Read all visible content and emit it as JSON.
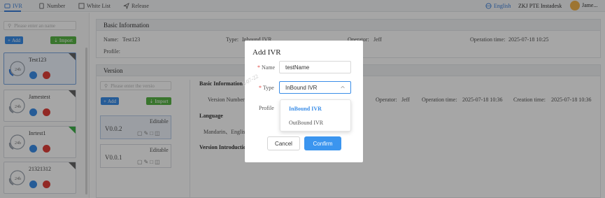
{
  "topnav": {
    "tabs": [
      {
        "label": "IVR"
      },
      {
        "label": "Number"
      },
      {
        "label": "White List"
      },
      {
        "label": "Release"
      }
    ],
    "language": "English",
    "company": "ZKJ PTE Instadesk",
    "user": "Jame..."
  },
  "sidebar": {
    "search_placeholder": "Please enter an name",
    "add_label": "Add",
    "import_label": "Import",
    "cards": [
      {
        "name": "Test123"
      },
      {
        "name": "Jamestest"
      },
      {
        "name": "Inrtest1"
      },
      {
        "name": "21321312"
      }
    ],
    "phone_badge": "24h"
  },
  "basic_info": {
    "title": "Basic Information",
    "name_label": "Name:",
    "name_value": "Test123",
    "type_label": "Type:",
    "type_value": "Inbound IVR",
    "operator_label": "Operator:",
    "operator_value": "Jeff",
    "optime_label": "Operation time:",
    "optime_value": "2025-07-18 10:25",
    "profile_label": "Profile:"
  },
  "version": {
    "title": "Version",
    "search_placeholder": "Please enter the versio",
    "add_label": "Add",
    "import_label": "Import",
    "items": [
      {
        "name": "V0.0.2",
        "status": "Editable"
      },
      {
        "name": "V0.0.1",
        "status": "Editable"
      }
    ],
    "detail": {
      "basic_heading": "Basic Information",
      "version_number_label": "Version Number",
      "operator_label": "Operator:",
      "operator_value": "Jeff",
      "optime_label": "Operation time:",
      "optime_value": "2025-07-18 10:36",
      "creation_label": "Creation time:",
      "creation_value": "2025-07-18 10:36",
      "language_heading": "Language",
      "language_value": "Mandarin、English",
      "intro_heading": "Version Introduction"
    }
  },
  "dialog": {
    "title": "Add IVR",
    "name_label": "Name",
    "name_value": "testName",
    "type_label": "Type",
    "type_value": "InBound IVR",
    "profile_label": "Profile",
    "cancel_label": "Cancel",
    "confirm_label": "Confirm",
    "options": [
      {
        "label": "InBound IVR",
        "selected": true
      },
      {
        "label": "OutBound IVR",
        "selected": false
      }
    ],
    "watermark": "5-07-22"
  },
  "colors": {
    "accent": "#3b8ee8",
    "success": "#58b446",
    "danger": "#e0403a"
  }
}
